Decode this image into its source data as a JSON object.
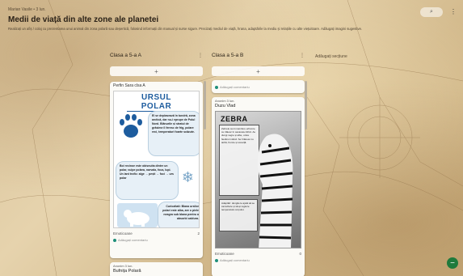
{
  "header": {
    "meta": "Marian Vasile • 3 lun.",
    "title": "Medii de viață din alte zone ale planetei",
    "description": "Realizați un afiș / colaj cu prezentarea unui animal din zona polară sau deșertică, folosind informații din manual și surse sigure. Precizați mediul de viață, hrana, adaptările la mediu și relațiile cu alte viețuitoare. Adăugați imagini sugestive."
  },
  "toolbar": {
    "search_icon": "search-icon",
    "more_icon": "more-dots-icon"
  },
  "columns": [
    {
      "title": "Clasa a 5-a A",
      "more": "⋮",
      "add": "+"
    },
    {
      "title": "Clasa a 5-a B",
      "more": "⋮",
      "add": "+"
    }
  ],
  "add_section_label": "Adăugați secțiune",
  "colA": {
    "card1": {
      "author": "Perfin Sara clsa A",
      "poster_title": "URSUL POLAR",
      "bubble1": "El se deplasează în tundră, zona arctică, dar nu-i eprupe de Polul Nord. Blănurile și stratul de grăsime îl feresc de frig, polare reci, temperaturi foarte scăzute.",
      "bubble2": "Boi recinoe este obisnuita dintre un polar, vulpe polara, narvala, foca, lupi. Un lant trofic: alge → pești → foci → urs polar",
      "bubble3": "Curiozitati: Blana ursilor polari este alba, are o piele neagra sub blana pentru a absorbi caldura.",
      "likes": "Emoticoane",
      "count": "2",
      "comment": "Adăugați comentariu"
    },
    "card2": {
      "meta": "Anonim 3 lun.",
      "title": "Bufnița Polară"
    }
  },
  "colB": {
    "card1": {
      "meta": "...",
      "comment": "Adăugați comentariu"
    },
    "card2": {
      "meta": "Anonim 3 lun.",
      "title": "Duzu Vlad",
      "poster_title": "ZEBRA",
      "box1": "Zebrele sunt mamifere erbivore ce trăiesc în savanele Africii. Au dungi negre și albe, unice fiecărui individ. Se hrănesc cu iarbă, frunze și scoarță.",
      "box2": "Adaptări: dungile le ajută să se camufleze și să-și regleze temperatura corpului.",
      "likes": "Emoticoane",
      "count": "0",
      "comment": "Adăugați comentariu"
    }
  },
  "fab_label": "−"
}
